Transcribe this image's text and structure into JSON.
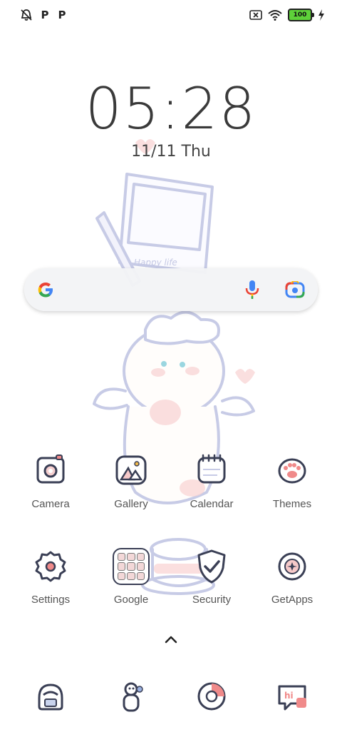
{
  "status_bar": {
    "left_icons": [
      "mute-bell-icon",
      "p-icon",
      "p-icon"
    ],
    "p_label": "P",
    "right_icons": [
      "sim-x-icon",
      "wifi-icon",
      "battery-icon",
      "charging-icon"
    ],
    "battery_level": "100"
  },
  "lockscreen": {
    "time": "05:28",
    "date": "11/11 Thu"
  },
  "search": {
    "icons": [
      "google-g-icon",
      "microphone-icon",
      "google-lens-icon"
    ]
  },
  "apps": [
    {
      "label": "Camera",
      "icon": "camera-icon"
    },
    {
      "label": "Gallery",
      "icon": "gallery-icon"
    },
    {
      "label": "Calendar",
      "icon": "calendar-icon"
    },
    {
      "label": "Themes",
      "icon": "paw-icon"
    },
    {
      "label": "Settings",
      "icon": "gear-icon"
    },
    {
      "label": "Google",
      "icon": "folder-icon"
    },
    {
      "label": "Security",
      "icon": "shield-icon"
    },
    {
      "label": "GetApps",
      "icon": "getapps-icon"
    }
  ],
  "dock": [
    {
      "icon": "phone-icon"
    },
    {
      "icon": "snowman-icon"
    },
    {
      "icon": "browser-icon"
    },
    {
      "icon": "messages-icon"
    }
  ],
  "colors": {
    "outline": "#3a3f55",
    "pink": "#f6c9c9",
    "wallpaper_line": "#c9cde8"
  }
}
